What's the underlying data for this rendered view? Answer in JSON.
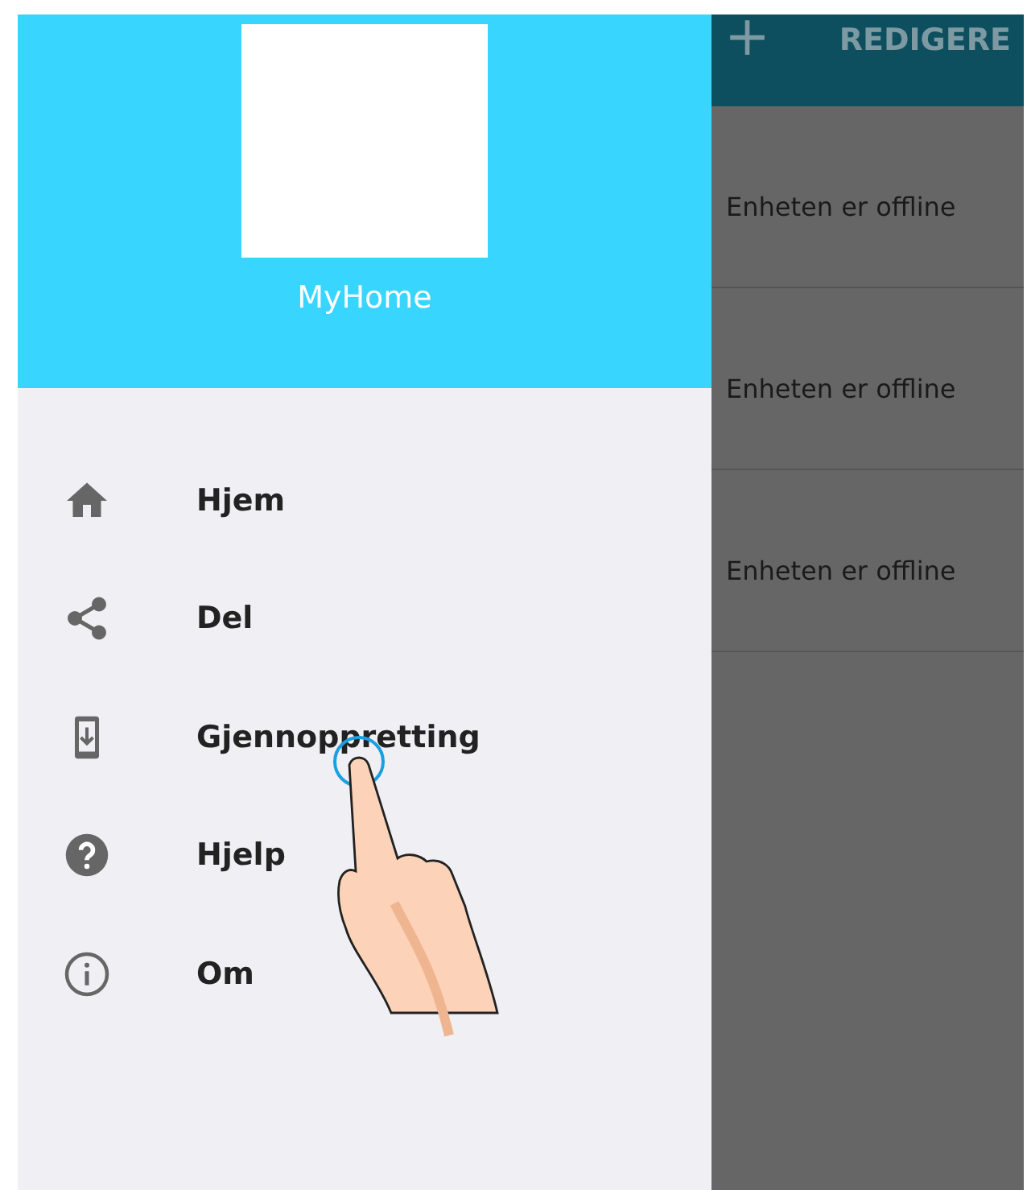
{
  "drawer": {
    "app_name": "MyHome",
    "menu": [
      {
        "label": "Hjem"
      },
      {
        "label": "Del"
      },
      {
        "label": "Gjennoppretting"
      },
      {
        "label": "Hjelp"
      },
      {
        "label": "Om"
      }
    ]
  },
  "toolbar": {
    "add_icon": "+",
    "edit_button": "REDIGERE"
  },
  "devices": [
    {
      "status": "Enheten er offline"
    },
    {
      "status": "Enheten er offline"
    },
    {
      "status": "Enheten er offline"
    }
  ]
}
